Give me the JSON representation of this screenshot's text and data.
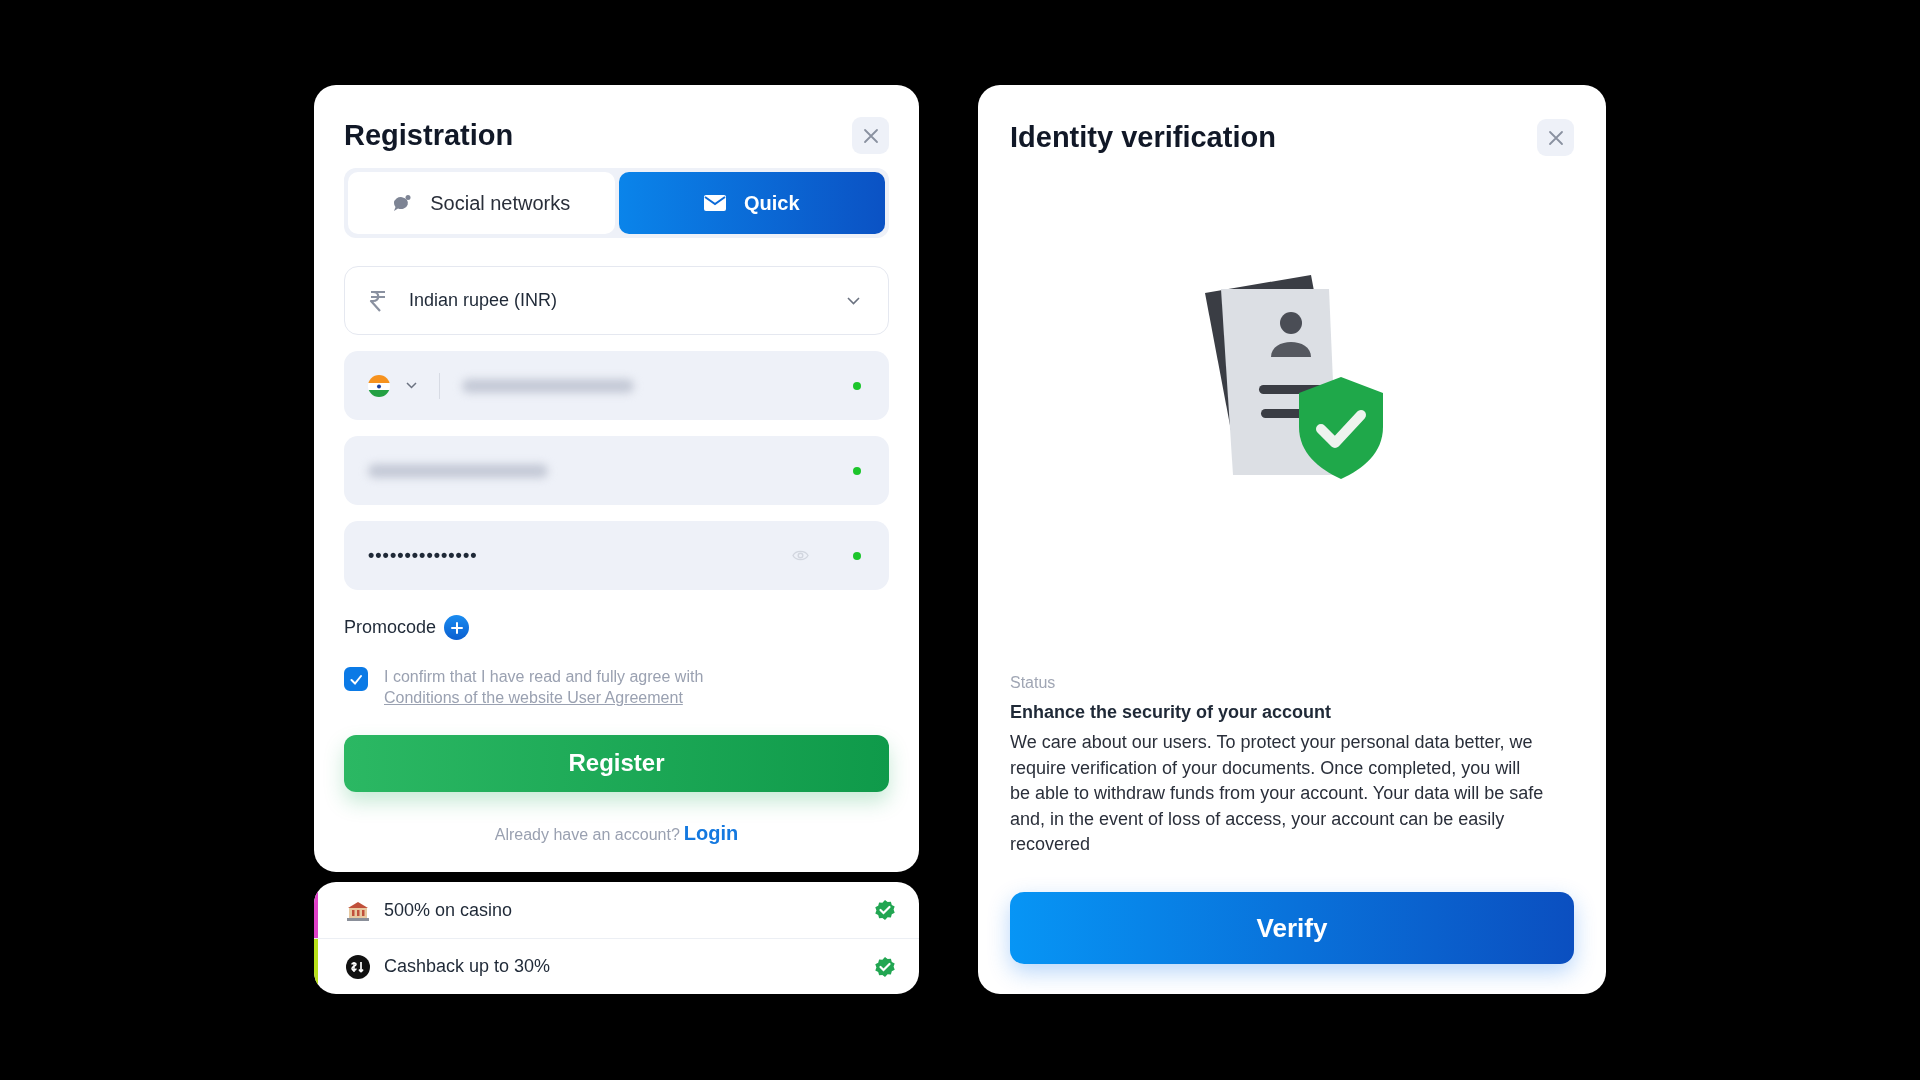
{
  "registration": {
    "title": "Registration",
    "tabs": [
      {
        "label": "Social networks",
        "selected": false
      },
      {
        "label": "Quick",
        "selected": true
      }
    ],
    "currency": {
      "value": "Indian rupee (INR)"
    },
    "phone": {
      "valid": true
    },
    "email": {
      "valid": true
    },
    "password": {
      "value": "•••••••••••••••",
      "valid": true
    },
    "promocode": {
      "label": "Promocode"
    },
    "agreement": {
      "checked": true,
      "text": "I confirm that I have read and fully agree with",
      "link": "Conditions of the website User Agreement"
    },
    "register_button": "Register",
    "login_prompt": "Already have an account?",
    "login_link": "Login"
  },
  "bonuses": [
    {
      "label": "500% on casino",
      "color": "#e040c8",
      "done": true
    },
    {
      "label": "Cashback up to 30%",
      "color": "#b8e01a",
      "done": true
    }
  ],
  "verification": {
    "title": "Identity verification",
    "status_label": "Status",
    "heading": "Enhance the security of your account",
    "body": "We care about our users. To protect your personal data better, we require verification of your documents. Once completed, you will be able to withdraw funds from your account. Your data will be safe and, in the event of loss of access, your account can be easily recovered",
    "button": "Verify"
  }
}
